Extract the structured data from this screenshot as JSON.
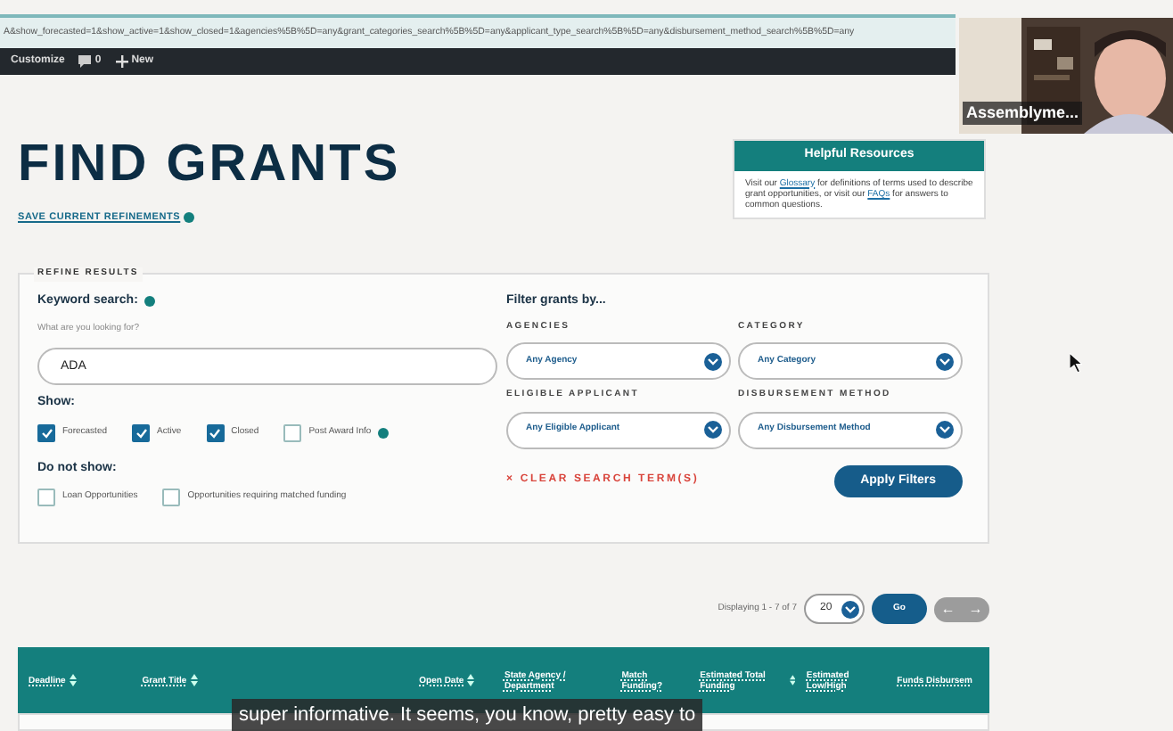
{
  "browser": {
    "url": "A&show_forecasted=1&show_active=1&show_closed=1&agencies%5B%5D=any&grant_categories_search%5B%5D=any&applicant_type_search%5B%5D=any&disbursement_method_search%5B%5D=any",
    "toolbar": [
      {
        "kind": "customize",
        "label": "Customize"
      },
      {
        "kind": "comments",
        "label": "0"
      },
      {
        "kind": "new",
        "label": "New"
      }
    ]
  },
  "video_tile": {
    "name": "Assemblyme..."
  },
  "page": {
    "title": "FIND GRANTS",
    "save_link": "SAVE CURRENT REFINEMENTS",
    "resources": {
      "title": "Helpful Resources",
      "parts": [
        {
          "text": "Visit our ",
          "link": false
        },
        {
          "text": "Glossary",
          "link": true
        },
        {
          "text": " for definitions of terms used to describe grant opportunities, or visit our ",
          "link": false
        },
        {
          "text": "FAQs",
          "link": true
        },
        {
          "text": " for answers to common questions.",
          "link": false
        }
      ]
    }
  },
  "refine": {
    "legend": "REFINE RESULTS",
    "keyword_label": "Keyword search:",
    "keyword_hint": "What are you looking for?",
    "keyword_value": "ADA",
    "show_label": "Show:",
    "show_options": [
      {
        "label": "Forecasted",
        "checked": true,
        "info": false
      },
      {
        "label": "Active",
        "checked": true,
        "info": false
      },
      {
        "label": "Closed",
        "checked": true,
        "info": false
      },
      {
        "label": "Post Award Info",
        "checked": false,
        "info": true
      }
    ],
    "hide_label": "Do not show:",
    "hide_options": [
      {
        "label": "Loan Opportunities",
        "checked": false
      },
      {
        "label": "Opportunities requiring matched funding",
        "checked": false
      }
    ],
    "filter_title": "Filter grants by...",
    "filters": [
      {
        "label": "AGENCIES",
        "value": "Any Agency"
      },
      {
        "label": "CATEGORY",
        "value": "Any Category"
      },
      {
        "label": "ELIGIBLE APPLICANT",
        "value": "Any Eligible Applicant"
      },
      {
        "label": "DISBURSEMENT METHOD",
        "value": "Any Disbursement Method"
      }
    ],
    "clear_icon": "×",
    "clear_label": "CLEAR SEARCH TERM(S)",
    "apply": "Apply Filters"
  },
  "pagination": {
    "text": "Displaying 1 - 7 of 7",
    "per_page": "20",
    "go": "Go",
    "prev": "←",
    "next": "→",
    "disabled": true
  },
  "table": {
    "columns": [
      {
        "label": "Deadline",
        "sortable": true
      },
      {
        "label": "Grant Title",
        "sortable": true
      },
      {
        "label": "Open Date",
        "sortable": true
      },
      {
        "label": "State Agency / Department",
        "sortable": false
      },
      {
        "label": "Match Funding?",
        "sortable": false
      },
      {
        "label": "Estimated Total Funding",
        "sortable": true
      },
      {
        "label": "Estimated Low/High",
        "sortable": false
      },
      {
        "label": "Funds Disbursem",
        "sortable": false
      }
    ]
  },
  "caption": "super informative. It seems, you know, pretty easy to"
}
